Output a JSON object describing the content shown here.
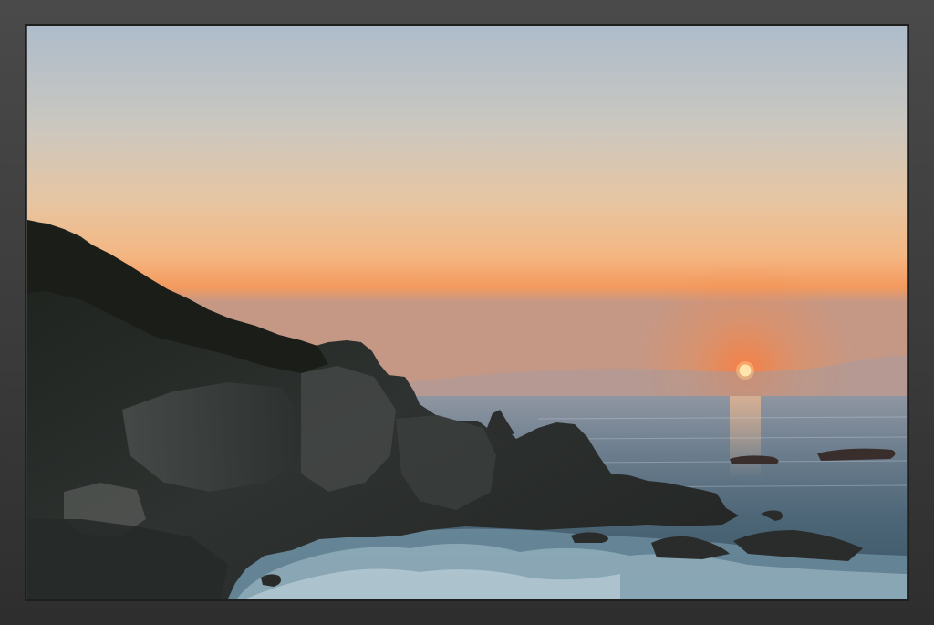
{
  "scene": {
    "subject": "sunset-over-ocean-with-rocky-cliff",
    "frame_color": "#3b3b3b",
    "sky_colors": [
      "#aebccb",
      "#d9cdb8",
      "#f4b682",
      "#f08a4e"
    ],
    "sun_color": "#fff4c8",
    "sea_color": "#3d5868",
    "rock_color": "#2a2b2a"
  }
}
